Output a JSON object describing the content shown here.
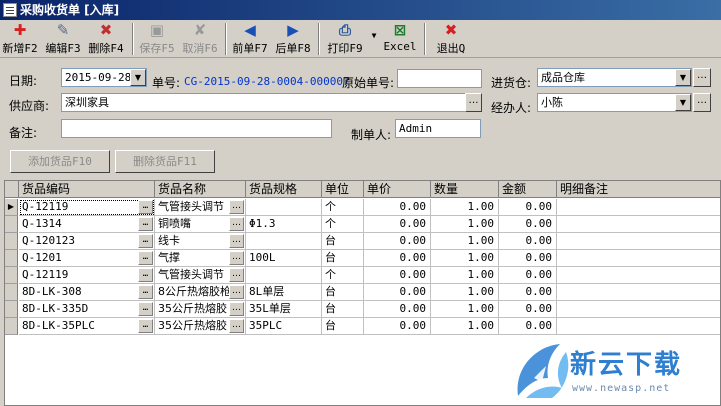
{
  "window": {
    "title": "采购收货单 [入库]"
  },
  "toolbar": {
    "new": "新增F2",
    "edit": "编辑F3",
    "delete": "删除F4",
    "save": "保存F5",
    "cancel": "取消F6",
    "prev": "前单F7",
    "next": "后单F8",
    "print": "打印F9",
    "excel": "Excel",
    "exit": "退出Q"
  },
  "form": {
    "date_label": "日期:",
    "date_value": "2015-09-28",
    "doc_no_label": "单号:",
    "doc_no_value": "CG-2015-09-28-0004-000007",
    "orig_no_label": "原始单号:",
    "orig_no_value": "",
    "warehouse_label": "进货仓:",
    "warehouse_value": "成品仓库",
    "supplier_label": "供应商:",
    "supplier_value": "深圳家具",
    "handler_label": "经办人:",
    "handler_value": "小陈",
    "remark_label": "备注:",
    "remark_value": "",
    "creator_label": "制单人:",
    "creator_value": "Admin"
  },
  "buttons": {
    "add_goods": "添加货品F10",
    "remove_goods": "删除货品F11"
  },
  "table": {
    "columns": [
      "货品编码",
      "货品名称",
      "货品规格",
      "单位",
      "单价",
      "数量",
      "金额",
      "明细备注"
    ],
    "rows": [
      {
        "code": "Q-12119",
        "name": "气管接头调节",
        "spec": "",
        "unit": "个",
        "price": "0.00",
        "qty": "1.00",
        "amount": "0.00",
        "note": ""
      },
      {
        "code": "Q-1314",
        "name": "铜喷嘴",
        "spec": "Φ1.3",
        "unit": "个",
        "price": "0.00",
        "qty": "1.00",
        "amount": "0.00",
        "note": ""
      },
      {
        "code": "Q-120123",
        "name": "线卡",
        "spec": "",
        "unit": "台",
        "price": "0.00",
        "qty": "1.00",
        "amount": "0.00",
        "note": ""
      },
      {
        "code": "Q-1201",
        "name": "气撑",
        "spec": "100L",
        "unit": "台",
        "price": "0.00",
        "qty": "1.00",
        "amount": "0.00",
        "note": ""
      },
      {
        "code": "Q-12119",
        "name": "气管接头调节",
        "spec": "",
        "unit": "个",
        "price": "0.00",
        "qty": "1.00",
        "amount": "0.00",
        "note": ""
      },
      {
        "code": "8D-LK-308",
        "name": "8公斤热熔胶枪",
        "spec": "8L单层",
        "unit": "台",
        "price": "0.00",
        "qty": "1.00",
        "amount": "0.00",
        "note": ""
      },
      {
        "code": "8D-LK-335D",
        "name": "35公斤热熔胶",
        "spec": "35L单层",
        "unit": "台",
        "price": "0.00",
        "qty": "1.00",
        "amount": "0.00",
        "note": ""
      },
      {
        "code": "8D-LK-35PLC",
        "name": "35公斤热熔胶",
        "spec": "35PLC",
        "unit": "台",
        "price": "0.00",
        "qty": "1.00",
        "amount": "0.00",
        "note": ""
      }
    ]
  },
  "watermark": {
    "name": "新云下载",
    "url": "www.newasp.net"
  },
  "icons": {
    "new": "plus-icon",
    "edit": "pencil-icon",
    "delete": "delete-icon",
    "save": "floppy-icon",
    "cancel": "cancel-x-icon",
    "prev": "arrow-left-icon",
    "next": "arrow-right-icon",
    "print": "printer-icon",
    "excel": "excel-icon",
    "exit": "exit-x-icon"
  },
  "colors": {
    "title_bar": "#0a246a",
    "doc_no": "#0033cc",
    "new_icon": "#d42020",
    "nav_icon": "#1a4fb5"
  }
}
